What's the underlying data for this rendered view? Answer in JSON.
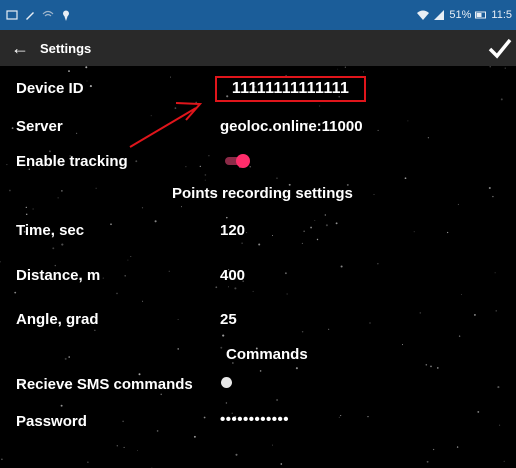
{
  "status_bar": {
    "battery_percent": "51%",
    "time": "11:5"
  },
  "toolbar": {
    "back_icon": "arrow-left-icon",
    "title": "Settings",
    "confirm_icon": "check-icon"
  },
  "settings": {
    "device_id": {
      "label": "Device ID",
      "value": "11111111111111"
    },
    "server": {
      "label": "Server",
      "value": "geoloc.online:11000"
    },
    "enable_tracking": {
      "label": "Enable tracking",
      "on": true
    },
    "points_section": "Points recording settings",
    "time": {
      "label": "Time, sec",
      "value": "120"
    },
    "distance": {
      "label": "Distance, m",
      "value": "400"
    },
    "angle": {
      "label": "Angle, grad",
      "value": "25"
    },
    "commands_section": "Commands",
    "sms_commands": {
      "label": "Recieve SMS commands",
      "checked": false
    },
    "password": {
      "label": "Password",
      "value": "••••••••••••"
    }
  },
  "colors": {
    "status_bar": "#1b5d99",
    "toolbar": "#292929",
    "highlight": "#e0151b",
    "toggle_on": "#ff2d6b"
  }
}
